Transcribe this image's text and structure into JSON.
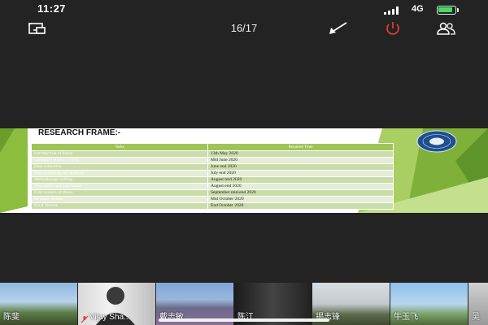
{
  "status_bar": {
    "time": "11:27",
    "network": "4G"
  },
  "toolbar": {
    "page_indicator": "16/17"
  },
  "slide": {
    "title": "RESEARCH FRAME:-",
    "table": {
      "headers": [
        "Tasks",
        "Required Time"
      ],
      "rows": [
        {
          "task": "Introduction of thesis",
          "time": "13th May 2020"
        },
        {
          "task": "Literature review writing",
          "time": "Mid June 2020"
        },
        {
          "task": "Data collection",
          "time": "June end 2020"
        },
        {
          "task": "Data screening and analysis",
          "time": "July end 2020"
        },
        {
          "task": "Methodology writing",
          "time": "August mid 2020"
        },
        {
          "task": "Discussion and conclusion",
          "time": "August end 2020"
        },
        {
          "task": "First version of thesis",
          "time": "September mid-end 2020"
        },
        {
          "task": "Revised Version",
          "time": "Mid October 2020"
        },
        {
          "task": "Final Version",
          "time": "End October 2020"
        }
      ]
    }
  },
  "participants": [
    {
      "name": "陈斐"
    },
    {
      "name": "Vijay Sha..."
    },
    {
      "name": "戴志敏"
    },
    {
      "name": "陈江"
    },
    {
      "name": "揭志锋"
    },
    {
      "name": "牛玉飞"
    },
    {
      "name": "吴"
    }
  ],
  "colors": {
    "accent_green": "#9fc357",
    "end_call_red": "#e53935",
    "background": "#232323"
  },
  "icons": [
    "screen-share-icon",
    "collapse-arrow-icon",
    "end-call-icon",
    "participants-icon",
    "muted-mic-icon"
  ]
}
